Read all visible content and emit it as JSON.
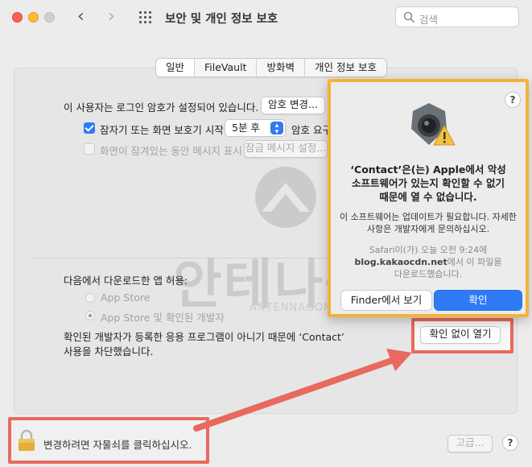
{
  "window": {
    "title": "보안 및 개인 정보 보호"
  },
  "search": {
    "placeholder": "검색"
  },
  "tabs": [
    {
      "label": "일반"
    },
    {
      "label": "FileVault"
    },
    {
      "label": "방화벽"
    },
    {
      "label": "개인 정보 보호"
    }
  ],
  "general": {
    "password_text": "이 사용자는 로그인 암호가 설정되어 있습니다.",
    "change_password_button": "암호 변경...",
    "sleep_label": "잠자기 또는 화면 보호기 시작",
    "sleep_value": "5분 후",
    "sleep_suffix": "암호 요구",
    "lock_message_label": "화면이 잠겨있는 동안 메시지 표시",
    "lock_message_button": "잠금 메시지 설정..."
  },
  "download": {
    "heading": "다음에서 다운로드한 앱 허용:",
    "option_store": "App Store",
    "option_store_dev": "App Store 및 확인된 개발자",
    "blocked_text_line1": "확인된 개발자가 등록한 응용 프로그램이 아니기 때문에 ‘Contact’",
    "blocked_text_line2": "사용을 차단했습니다.",
    "open_anyway_button": "확인 없이 열기"
  },
  "dialog": {
    "help": "?",
    "title_line1": "‘Contact’은(는) Apple에서 악성",
    "title_line2": "소프트웨어가 있는지 확인할 수 없기",
    "title_line3": "때문에 열 수 없습니다.",
    "body_line1": "이 소프트웨어는 업데이트가 필요합니다. 자세한",
    "body_line2": "사항은 개발자에게 문의하십시오.",
    "source_line1": "Safari이(가) 오늘 오전 9:24에",
    "source_host": "blog.kakaocdn.net",
    "source_line2_suffix": "에서 이 파일을",
    "source_line3": "다운로드했습니다.",
    "finder_button": "Finder에서 보기",
    "ok_button": "확인"
  },
  "footer": {
    "lock_text": "변경하려면 자물쇠를 클릭하십시오.",
    "advanced_button": "고급...",
    "help": "?"
  },
  "watermark": {
    "text": "안테나곰",
    "sub": "ANTENNAGOM.COM"
  },
  "colors": {
    "accent": "#2f7bf5",
    "highlight_red": "#e8695e",
    "dialog_border": "#f3b23a"
  }
}
